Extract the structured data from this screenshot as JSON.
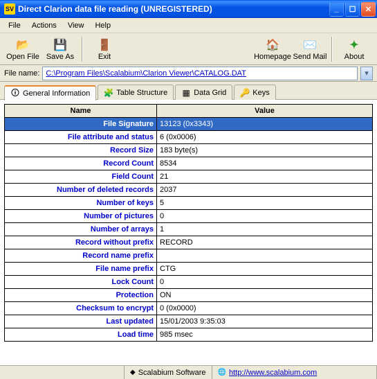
{
  "window": {
    "title": "Direct Clarion data file reading (UNREGISTERED)"
  },
  "menu": {
    "file": "File",
    "actions": "Actions",
    "view": "View",
    "help": "Help"
  },
  "toolbar": {
    "open": "Open File",
    "saveas": "Save As",
    "exit": "Exit",
    "homepage": "Homepage",
    "sendmail": "Send Mail",
    "about": "About"
  },
  "filebar": {
    "label": "File name:",
    "path": "C:\\Program Files\\Scalabium\\Clarion Viewer\\CATALOG.DAT"
  },
  "tabs": {
    "general": "General Information",
    "structure": "Table Structure",
    "grid": "Data Grid",
    "keys": "Keys"
  },
  "columns": {
    "name": "Name",
    "value": "Value"
  },
  "rows": [
    {
      "name": "File Signature",
      "value": "13123 (0x3343)",
      "selected": true
    },
    {
      "name": "File attribute and status",
      "value": "6 (0x0006)"
    },
    {
      "name": "Record Size",
      "value": "183 byte(s)"
    },
    {
      "name": "Record Count",
      "value": "8534"
    },
    {
      "name": "Field Count",
      "value": "21"
    },
    {
      "name": "Number of deleted records",
      "value": "2037"
    },
    {
      "name": "Number of keys",
      "value": "5"
    },
    {
      "name": "Number of pictures",
      "value": "0"
    },
    {
      "name": "Number of arrays",
      "value": "1"
    },
    {
      "name": "Record without prefix",
      "value": "RECORD"
    },
    {
      "name": "Record name prefix",
      "value": ""
    },
    {
      "name": "File name prefix",
      "value": "CTG"
    },
    {
      "name": "Lock Count",
      "value": "0"
    },
    {
      "name": "Protection",
      "value": "ON",
      "red": true
    },
    {
      "name": "Checksum to encrypt",
      "value": "0 (0x0000)"
    },
    {
      "name": "Last updated",
      "value": "15/01/2003 9:35:03"
    },
    {
      "name": "Load time",
      "value": "985 msec"
    }
  ],
  "status": {
    "vendor": "Scalabium Software",
    "url": "http://www.scalabium.com"
  }
}
